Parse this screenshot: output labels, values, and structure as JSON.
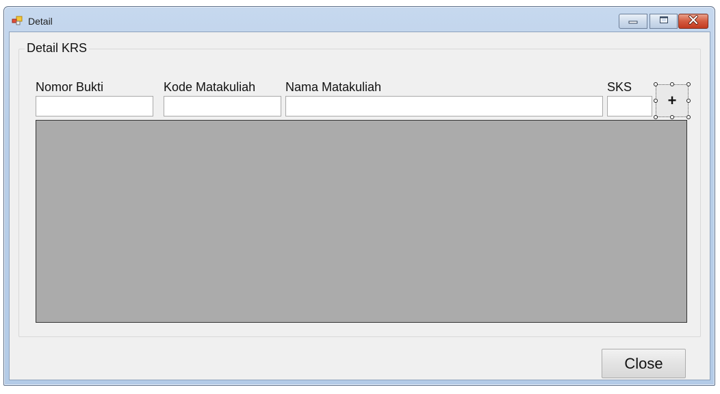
{
  "window": {
    "title": "Detail",
    "app_icon": "windows-form-icon",
    "controls": {
      "minimize_icon": "minimize-icon",
      "maximize_icon": "maximize-icon",
      "close_icon": "close-icon"
    }
  },
  "groupbox": {
    "title": "Detail KRS"
  },
  "fields": {
    "nomor_bukti": {
      "label": "Nomor Bukti",
      "value": ""
    },
    "kode_matakuliah": {
      "label": "Kode Matakuliah",
      "value": ""
    },
    "nama_matakuliah": {
      "label": "Nama Matakuliah",
      "value": ""
    },
    "sks": {
      "label": "SKS",
      "value": ""
    }
  },
  "add_button": {
    "label": "+"
  },
  "close_button": {
    "label": "Close"
  },
  "colors": {
    "grid_background": "#ababab",
    "client_background": "#f0f0f0",
    "titlebar": "#b9cfe9",
    "close_control": "#c9452a"
  }
}
